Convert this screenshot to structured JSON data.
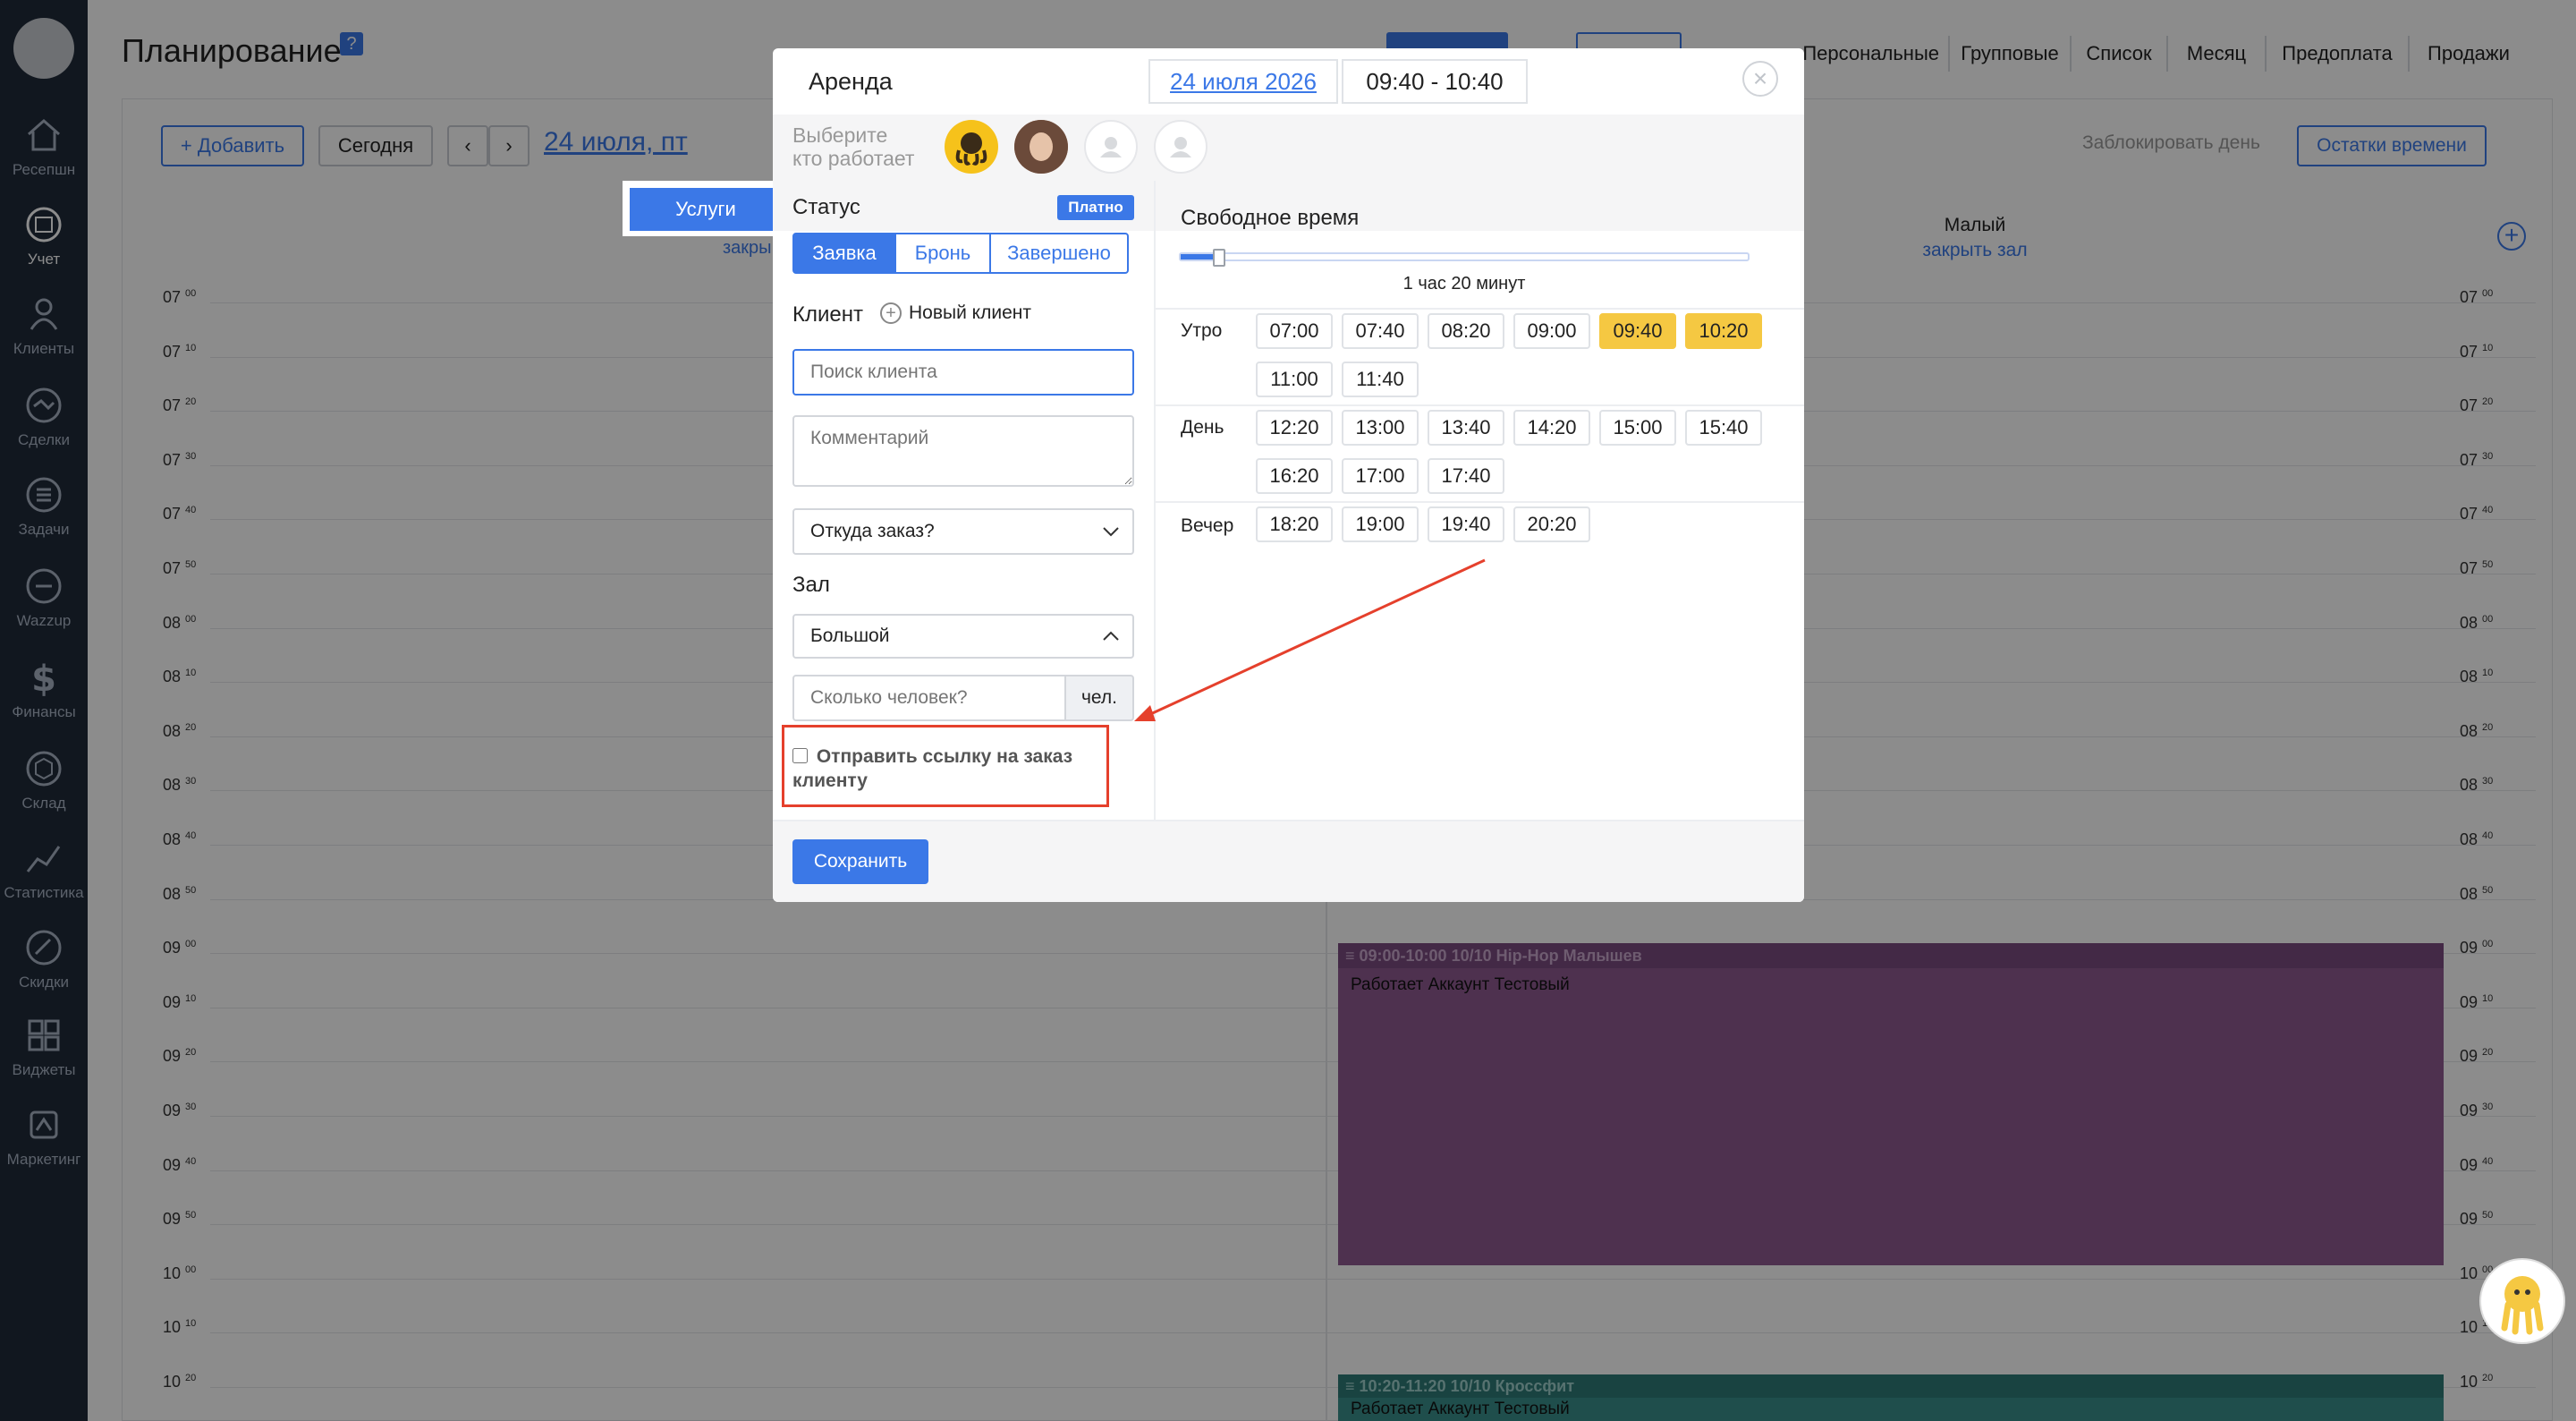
{
  "sidebar": {
    "items": [
      {
        "label": "Ресепшн",
        "icon": "house-icon"
      },
      {
        "label": "Учет",
        "icon": "calendar-icon"
      },
      {
        "label": "Клиенты",
        "icon": "person-icon"
      },
      {
        "label": "Сделки",
        "icon": "handshake-icon"
      },
      {
        "label": "Задачи",
        "icon": "tasks-icon"
      },
      {
        "label": "Wazzup",
        "icon": "wazzup-icon"
      },
      {
        "label": "Финансы",
        "icon": "dollar-icon"
      },
      {
        "label": "Склад",
        "icon": "box-icon"
      },
      {
        "label": "Статистика",
        "icon": "chart-icon"
      },
      {
        "label": "Скидки",
        "icon": "tag-icon"
      },
      {
        "label": "Виджеты",
        "icon": "widgets-icon"
      },
      {
        "label": "Маркетинг",
        "icon": "marketing-icon"
      }
    ]
  },
  "page": {
    "title": "Планирование",
    "help": "?",
    "view_tabs": [
      "Персональные",
      "Групповые",
      "Список",
      "Месяц",
      "Предоплата",
      "Продажи"
    ],
    "add_label": "+ Добавить",
    "today_label": "Сегодня",
    "current_date": "24 июля, пт",
    "block_day": "Заблокировать день",
    "time_left": "Остатки времени",
    "services_tab": "Услуги",
    "close_hall_left": "закры",
    "hall_small": "Малый",
    "hall_small_close": "закрыть зал",
    "times": [
      {
        "h": "07",
        "m": "00"
      },
      {
        "h": "07",
        "m": "10"
      },
      {
        "h": "07",
        "m": "20"
      },
      {
        "h": "07",
        "m": "30"
      },
      {
        "h": "07",
        "m": "40"
      },
      {
        "h": "07",
        "m": "50"
      },
      {
        "h": "08",
        "m": "00"
      },
      {
        "h": "08",
        "m": "10"
      },
      {
        "h": "08",
        "m": "20"
      },
      {
        "h": "08",
        "m": "30"
      },
      {
        "h": "08",
        "m": "40"
      },
      {
        "h": "08",
        "m": "50"
      },
      {
        "h": "09",
        "m": "00"
      },
      {
        "h": "09",
        "m": "10"
      },
      {
        "h": "09",
        "m": "20"
      },
      {
        "h": "09",
        "m": "30"
      },
      {
        "h": "09",
        "m": "40"
      },
      {
        "h": "09",
        "m": "50"
      },
      {
        "h": "10",
        "m": "00"
      },
      {
        "h": "10",
        "m": "10"
      },
      {
        "h": "10",
        "m": "20"
      }
    ],
    "events": [
      {
        "title": "≡ 09:00-10:00 10/10 Hip-Hop Малышев",
        "worker": "Работает Аккаунт Тестовый",
        "color": "#8e5a91"
      },
      {
        "title": "≡ 10:20-11:20 10/10 Кроссфит",
        "worker": "Работает Аккаунт Тестовый",
        "color": "#3a8f8b"
      }
    ]
  },
  "modal": {
    "title": "Аренда",
    "date": "24 июля 2026",
    "time_range": "09:40 - 10:40",
    "worker_prompt_1": "Выберите",
    "worker_prompt_2": "кто работает",
    "status_label": "Статус",
    "paid_badge": "Платно",
    "status_options": [
      "Заявка",
      "Бронь",
      "Завершено"
    ],
    "status_selected": "Заявка",
    "client_label": "Клиент",
    "new_client": "Новый клиент",
    "client_search_placeholder": "Поиск клиента",
    "comment_placeholder": "Комментарий",
    "source_select": "Откуда заказ?",
    "hall_label": "Зал",
    "hall_value": "Большой",
    "people_placeholder": "Сколько человек?",
    "people_unit": "чел.",
    "send_link_line1": "Отправить ссылку на заказ",
    "send_link_line2": "клиенту",
    "send_link_checked": false,
    "free_time_label": "Свободное время",
    "duration_label": "1 час 20 минут",
    "duration_fraction": 0.05,
    "save_label": "Сохранить",
    "periods": [
      {
        "label": "Утро",
        "slots": [
          "07:00",
          "07:40",
          "08:20",
          "09:00",
          "09:40",
          "10:20",
          "11:00",
          "11:40"
        ]
      },
      {
        "label": "День",
        "slots": [
          "12:20",
          "13:00",
          "13:40",
          "14:20",
          "15:00",
          "15:40",
          "16:20",
          "17:00",
          "17:40"
        ]
      },
      {
        "label": "Вечер",
        "slots": [
          "18:20",
          "19:00",
          "19:40",
          "20:20"
        ]
      }
    ],
    "selected_slots": [
      "09:40",
      "10:20"
    ]
  },
  "colors": {
    "accent": "#3b78e7",
    "highlight": "#e5402c",
    "sidebar": "#1f2a3a",
    "slot_selected": "#f5c842"
  }
}
